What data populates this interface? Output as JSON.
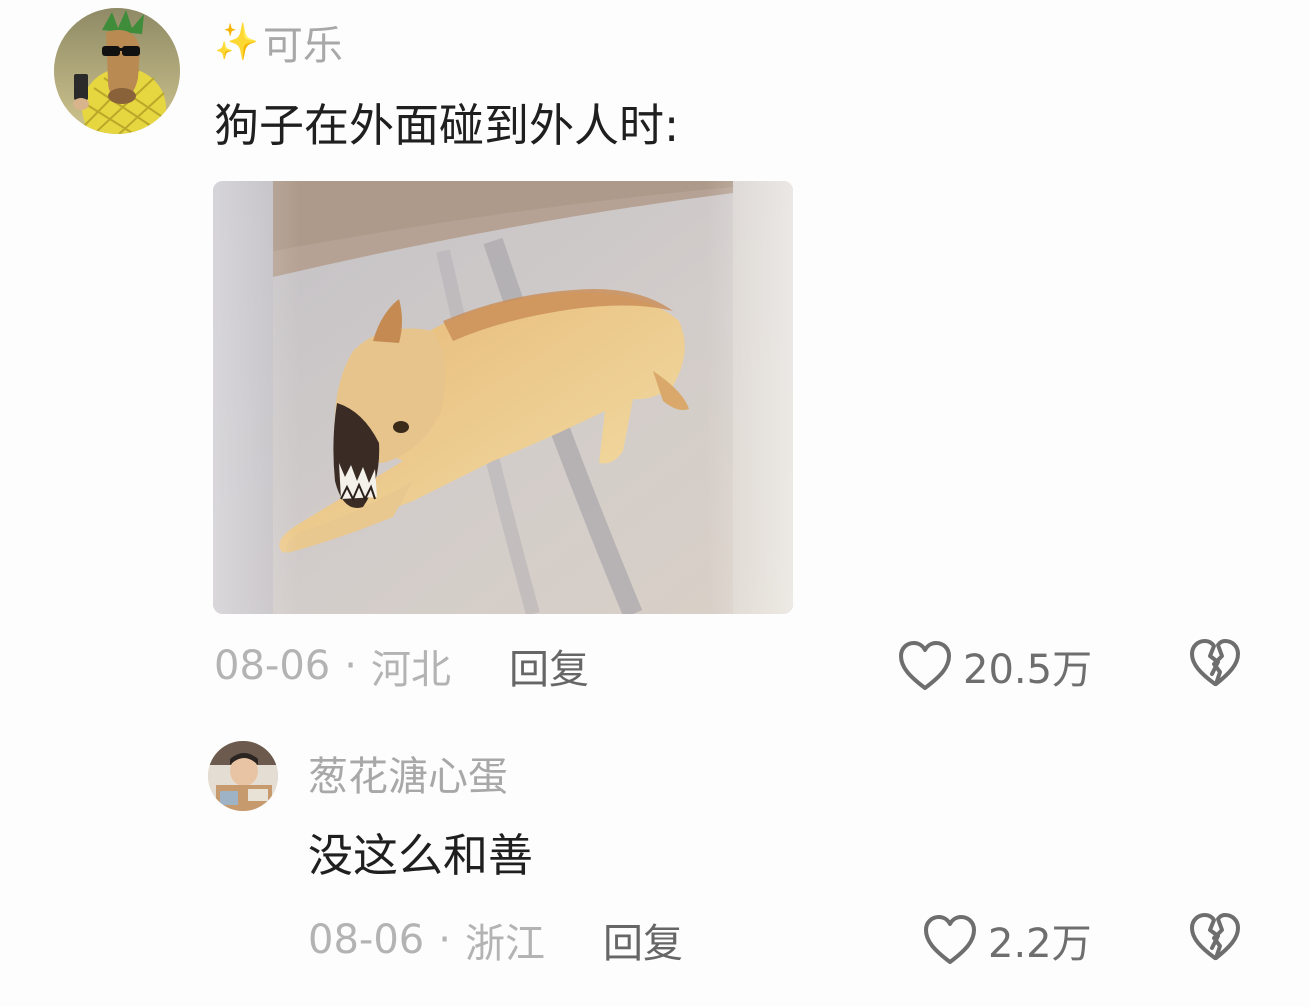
{
  "comment": {
    "username": "可乐",
    "username_prefix": "✨",
    "text": "狗子在外面碰到外人时:",
    "date": "08-06",
    "separator": "·",
    "location": "河北",
    "reply_label": "回复",
    "likes": "20.5万"
  },
  "sub_reply": {
    "username": "葱花溏心蛋",
    "text": "没这么和善",
    "date": "08-06",
    "separator": "·",
    "location": "浙江",
    "reply_label": "回复",
    "likes": "2.2万"
  },
  "colors": {
    "background": "#fdfdfd",
    "username": "#a8a8a8",
    "text": "#1f1f1f",
    "meta": "#b3b3b3",
    "reply": "#666666",
    "icon": "#6e6e6e"
  },
  "icons": {
    "like": "heart-outline-icon",
    "dislike": "broken-heart-icon"
  }
}
